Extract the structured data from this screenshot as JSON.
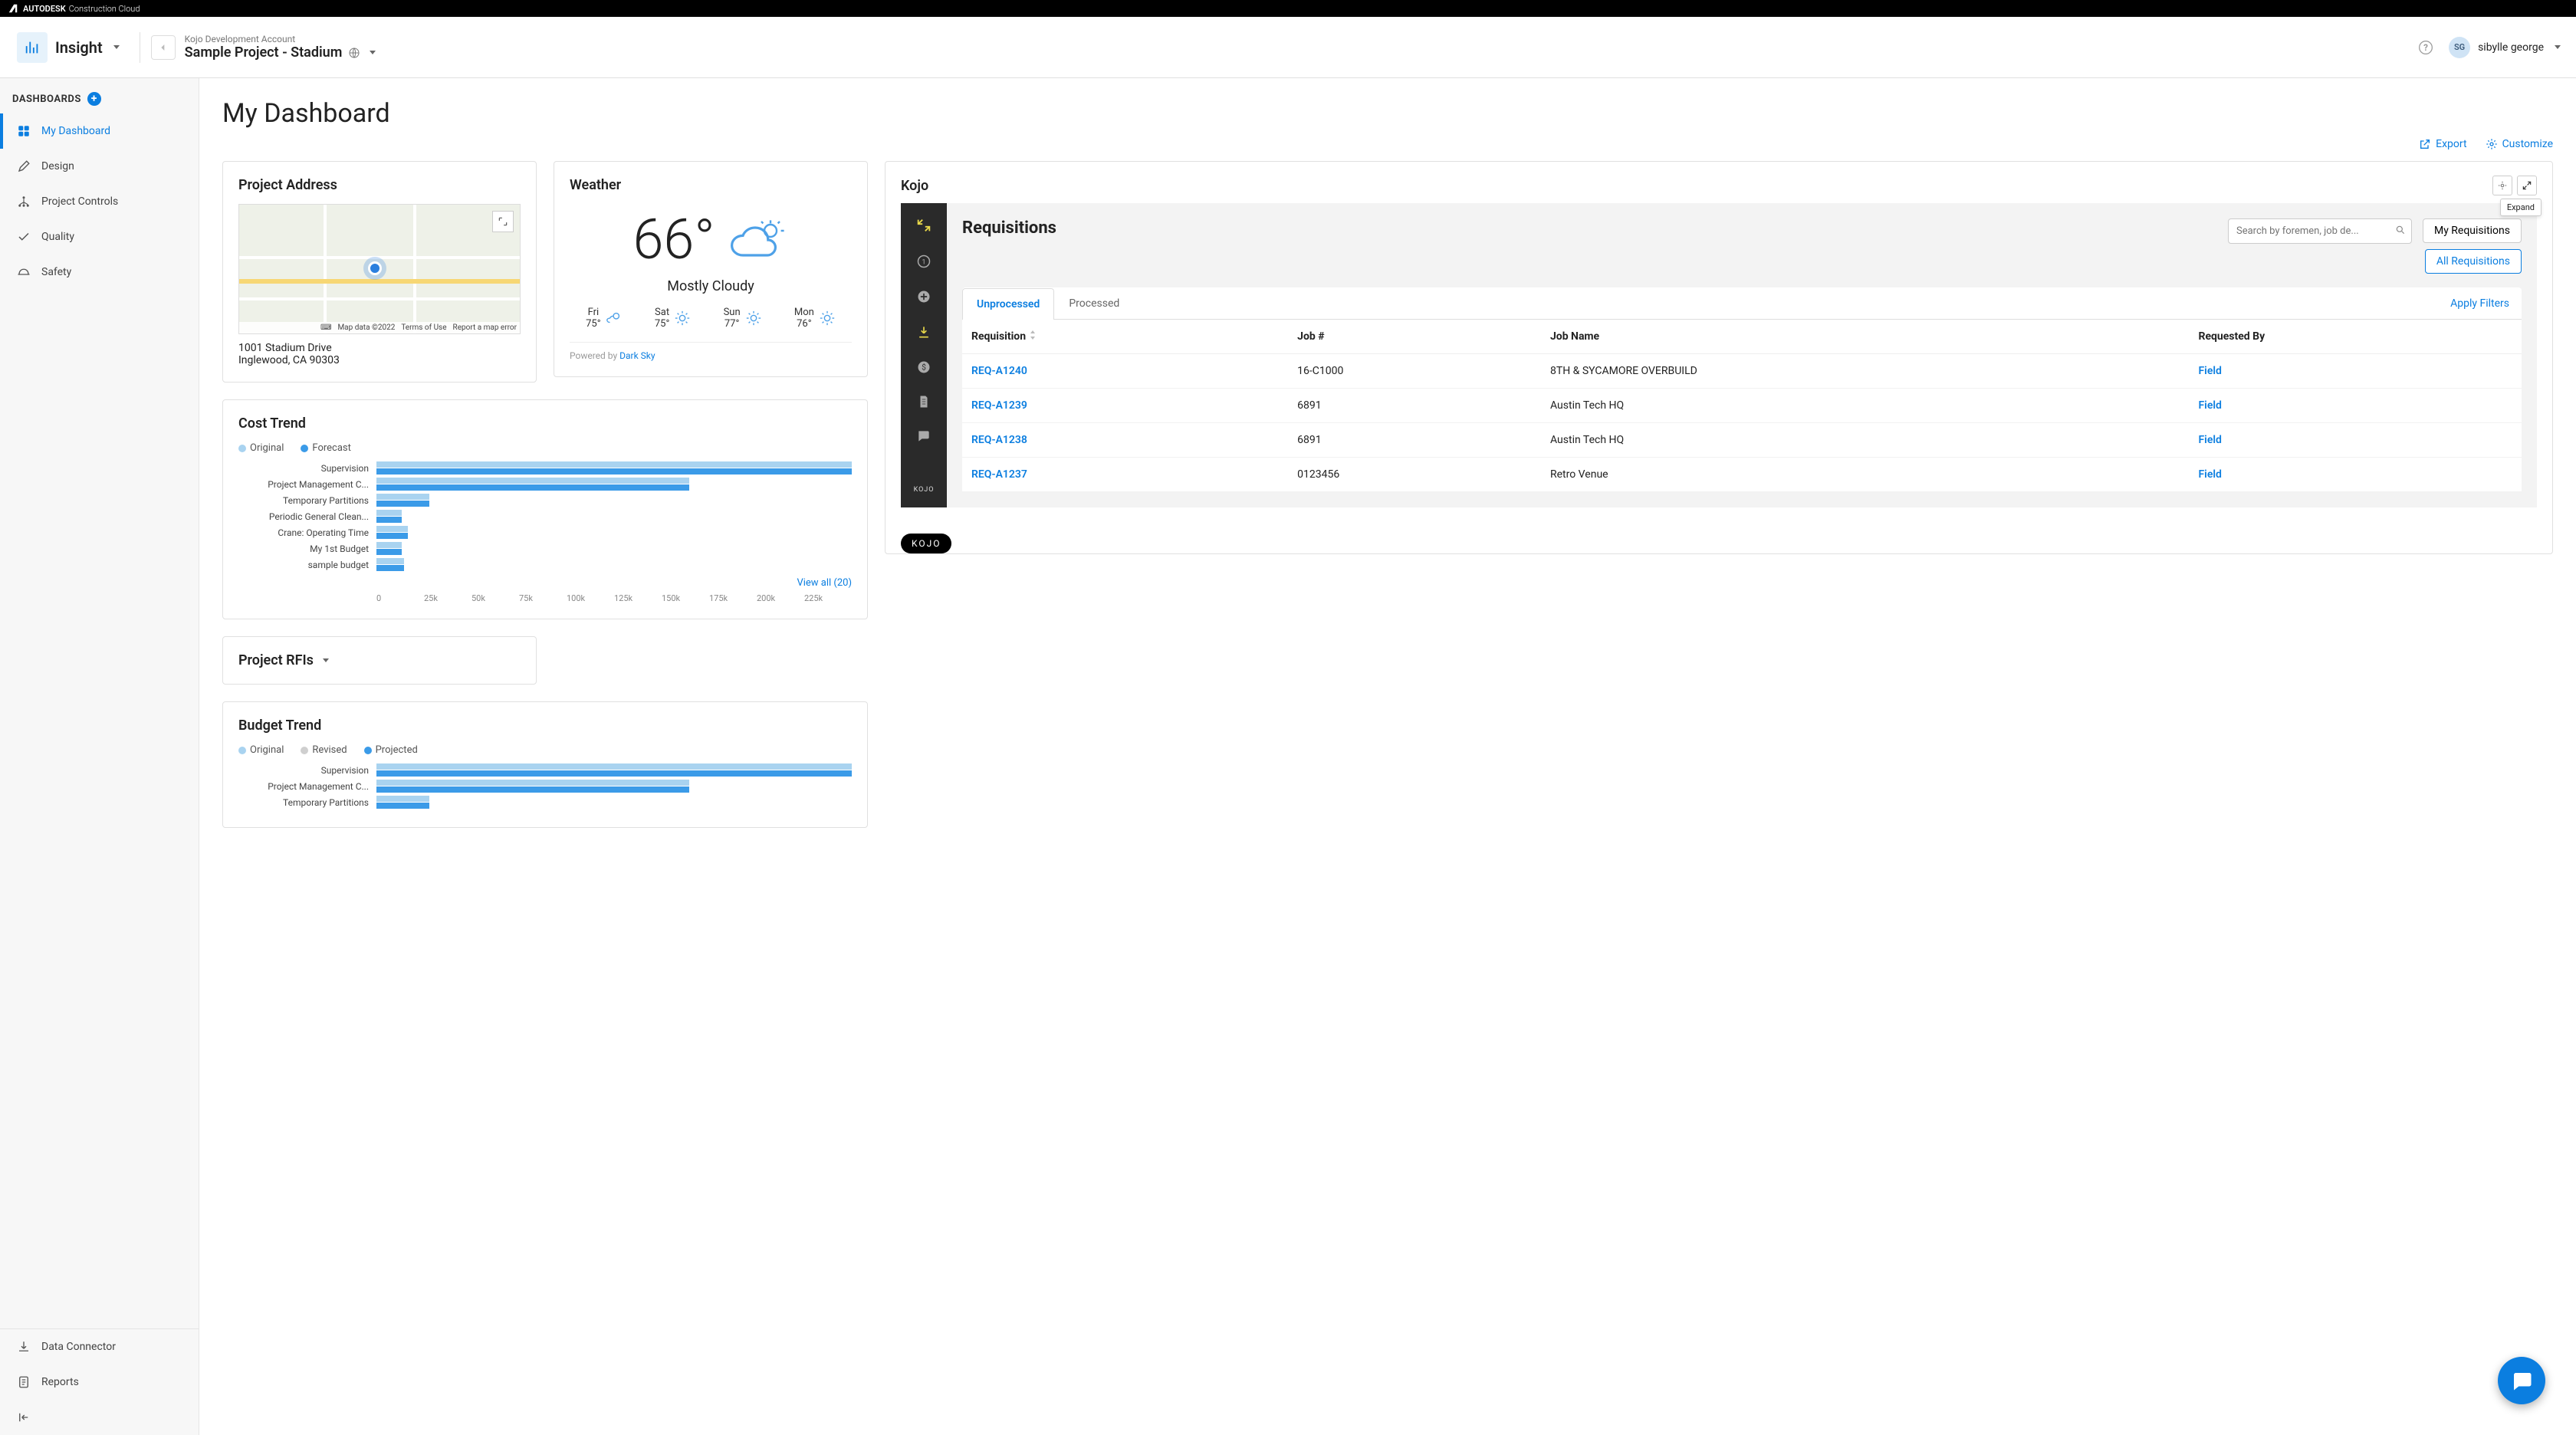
{
  "brand": {
    "name": "AUTODESK",
    "suffix": "Construction Cloud"
  },
  "module": {
    "name": "Insight"
  },
  "account": "Kojo Development Account",
  "project": "Sample Project - Stadium",
  "user": {
    "initials": "SG",
    "name": "sibylle george"
  },
  "sidebar": {
    "heading": "DASHBOARDS",
    "items": [
      {
        "label": "My Dashboard",
        "active": true
      },
      {
        "label": "Design"
      },
      {
        "label": "Project Controls"
      },
      {
        "label": "Quality"
      },
      {
        "label": "Safety"
      }
    ],
    "bottom": [
      {
        "label": "Data Connector"
      },
      {
        "label": "Reports"
      }
    ]
  },
  "page": {
    "title": "My Dashboard"
  },
  "actions": {
    "export": "Export",
    "customize": "Customize"
  },
  "address_card": {
    "title": "Project Address",
    "line1": "1001 Stadium Drive",
    "line2": "Inglewood, CA 90303",
    "map_attr": {
      "keyboard": "Keyboard shortcuts",
      "data": "Map data ©2022",
      "terms": "Terms of Use",
      "report": "Report a map error"
    }
  },
  "weather_card": {
    "title": "Weather",
    "temp": "66°",
    "condition": "Mostly Cloudy",
    "forecast": [
      {
        "day": "Fri",
        "temp": "75°"
      },
      {
        "day": "Sat",
        "temp": "75°"
      },
      {
        "day": "Sun",
        "temp": "77°"
      },
      {
        "day": "Mon",
        "temp": "76°"
      }
    ],
    "powered_prefix": "Powered by ",
    "powered_link": "Dark Sky"
  },
  "kojo_card": {
    "title": "Kojo",
    "tooltip": "Expand",
    "req_title": "Requisitions",
    "search_placeholder": "Search by foremen, job de...",
    "my_req": "My Requisitions",
    "all_req": "All Requisitions",
    "tab_unprocessed": "Unprocessed",
    "tab_processed": "Processed",
    "apply_filters": "Apply Filters",
    "columns": {
      "req": "Requisition",
      "job_no": "Job #",
      "job_name": "Job Name",
      "requested_by": "Requested By"
    },
    "rows": [
      {
        "req": "REQ-A1240",
        "job_no": "16-C1000",
        "job_name": "8TH & SYCAMORE OVERBUILD",
        "by": "Field"
      },
      {
        "req": "REQ-A1239",
        "job_no": "6891",
        "job_name": "Austin Tech HQ",
        "by": "Field"
      },
      {
        "req": "REQ-A1238",
        "job_no": "6891",
        "job_name": "Austin Tech HQ",
        "by": "Field"
      },
      {
        "req": "REQ-A1237",
        "job_no": "0123456",
        "job_name": "Retro Venue",
        "by": "Field"
      }
    ],
    "logo": "KOJO",
    "rail_logo": "KOJO"
  },
  "cost_trend": {
    "title": "Cost Trend",
    "legend": {
      "original": "Original",
      "forecast": "Forecast"
    },
    "view_all": "View all (20)",
    "xaxis": [
      "0",
      "25k",
      "50k",
      "75k",
      "100k",
      "125k",
      "150k",
      "175k",
      "200k",
      "225k"
    ]
  },
  "budget_trend": {
    "title": "Budget Trend",
    "legend": {
      "original": "Original",
      "revised": "Revised",
      "projected": "Projected"
    }
  },
  "rfi_card": {
    "title": "Project RFIs"
  },
  "chart_data": [
    {
      "type": "bar",
      "title": "Cost Trend",
      "orientation": "horizontal",
      "xlim": [
        0,
        225000
      ],
      "categories": [
        "Supervision",
        "Project Management C...",
        "Temporary Partitions",
        "Periodic General Clean...",
        "Crane: Operating Time",
        "My 1st Budget",
        "sample budget"
      ],
      "series": [
        {
          "name": "Original",
          "color": "#a9d3f0",
          "values": [
            225000,
            148000,
            25000,
            12000,
            15000,
            12000,
            13000
          ]
        },
        {
          "name": "Forecast",
          "color": "#3b9be8",
          "values": [
            225000,
            148000,
            25000,
            12000,
            15000,
            12000,
            13000
          ]
        }
      ],
      "xticks": [
        0,
        25000,
        50000,
        75000,
        100000,
        125000,
        150000,
        175000,
        200000,
        225000
      ]
    },
    {
      "type": "bar",
      "title": "Budget Trend",
      "orientation": "horizontal",
      "xlim": [
        0,
        225000
      ],
      "categories": [
        "Supervision",
        "Project Management C...",
        "Temporary Partitions"
      ],
      "series": [
        {
          "name": "Original",
          "color": "#a9d3f0",
          "values": [
            225000,
            148000,
            25000
          ]
        },
        {
          "name": "Revised",
          "color": "#cfcfcf",
          "values": [
            225000,
            148000,
            25000
          ]
        },
        {
          "name": "Projected",
          "color": "#3b9be8",
          "values": [
            225000,
            148000,
            25000
          ]
        }
      ]
    }
  ]
}
